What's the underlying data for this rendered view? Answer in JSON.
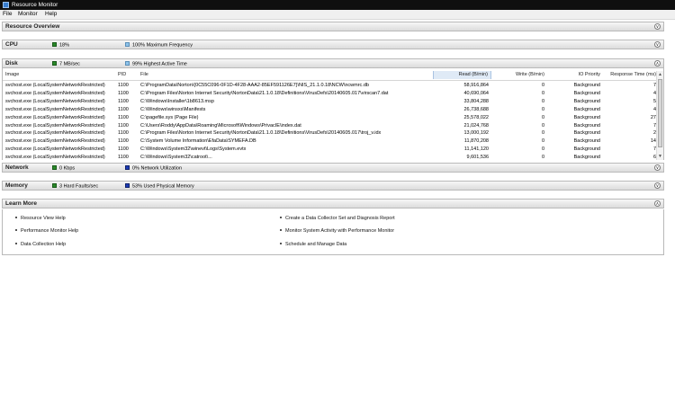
{
  "window": {
    "title": "Resource Monitor"
  },
  "menu": [
    "File",
    "Monitor",
    "Help"
  ],
  "resource_overview": {
    "title": "Resource Overview"
  },
  "cpu": {
    "title": "CPU",
    "usage": "18%",
    "frequency": "100% Maximum Frequency"
  },
  "disk": {
    "title": "Disk",
    "io_rate": "7 MB/sec",
    "active_time": "99% Highest Active Time",
    "columns": [
      "Image",
      "PID",
      "File",
      "Read (B/min)",
      "Write (B/min)",
      "IO Priority",
      "Response Time (ms)"
    ],
    "rows": [
      [
        "svchost.exe (LocalSystemNetworkRestricted)",
        "1100",
        "C:\\ProgramData\\Norton\\{0C55C096-0F1D-4F28-AAA2-85EF591126E7}\\NIS_21.1.0.18\\NCW\\ncwmrc.db",
        "58,916,864",
        "0",
        "Background",
        "7"
      ],
      [
        "svchost.exe (LocalSystemNetworkRestricted)",
        "1100",
        "C:\\Program Files\\Norton Internet Security\\NortonData\\21.1.0.18\\Definitions\\VirusDefs\\20140605.017\\virscan7.dat",
        "40,690,064",
        "0",
        "Background",
        "4"
      ],
      [
        "svchost.exe (LocalSystemNetworkRestricted)",
        "1100",
        "C:\\Windows\\Installer\\1b8613.msp",
        "33,804,288",
        "0",
        "Background",
        "5"
      ],
      [
        "svchost.exe (LocalSystemNetworkRestricted)",
        "1100",
        "C:\\Windows\\winsxs\\Manifests",
        "26,738,688",
        "0",
        "Background",
        "4"
      ],
      [
        "svchost.exe (LocalSystemNetworkRestricted)",
        "1100",
        "C:\\pagefile.sys (Page File)",
        "25,578,022",
        "0",
        "Background",
        "27"
      ],
      [
        "svchost.exe (LocalSystemNetworkRestricted)",
        "1100",
        "C:\\Users\\Roddy\\AppData\\Roaming\\Microsoft\\Windows\\PrivacIE\\index.dat",
        "21,024,768",
        "0",
        "Background",
        "7"
      ],
      [
        "svchost.exe (LocalSystemNetworkRestricted)",
        "1100",
        "C:\\Program Files\\Norton Internet Security\\NortonData\\21.1.0.18\\Definitions\\VirusDefs\\20140605.017\\troj_v.idx",
        "13,000,192",
        "0",
        "Background",
        "2"
      ],
      [
        "svchost.exe (LocalSystemNetworkRestricted)",
        "1100",
        "C:\\System Volume Information\\EfaData\\SYMEFA.DB",
        "11,870,208",
        "0",
        "Background",
        "14"
      ],
      [
        "svchost.exe (LocalSystemNetworkRestricted)",
        "1100",
        "C:\\Windows\\System32\\winevt\\Logs\\System.evtx",
        "11,141,120",
        "0",
        "Background",
        "7"
      ],
      [
        "svchost.exe (LocalSystemNetworkRestricted)",
        "1100",
        "C:\\Windows\\System32\\catroot\\...",
        "9,601,536",
        "0",
        "Background",
        "6"
      ]
    ]
  },
  "network": {
    "title": "Network",
    "rate": "0 Kbps",
    "utilization": "0% Network Utilization"
  },
  "memory": {
    "title": "Memory",
    "faults": "3 Hard Faults/sec",
    "used": "53% Used Physical Memory"
  },
  "learn_more": {
    "title": "Learn More",
    "links_left": [
      "Resource View Help",
      "Performance Monitor Help",
      "Data Collection Help"
    ],
    "links_right": [
      "Create a Data Collector Set and Diagnosis Report",
      "Monitor System Activity with Performance Monitor",
      "Schedule and Manage Data"
    ]
  },
  "colors": {
    "green_indicator": "#2a8a2a",
    "light_blue_indicator": "#8ec3ea",
    "dark_blue_indicator": "#1e3cb5"
  }
}
